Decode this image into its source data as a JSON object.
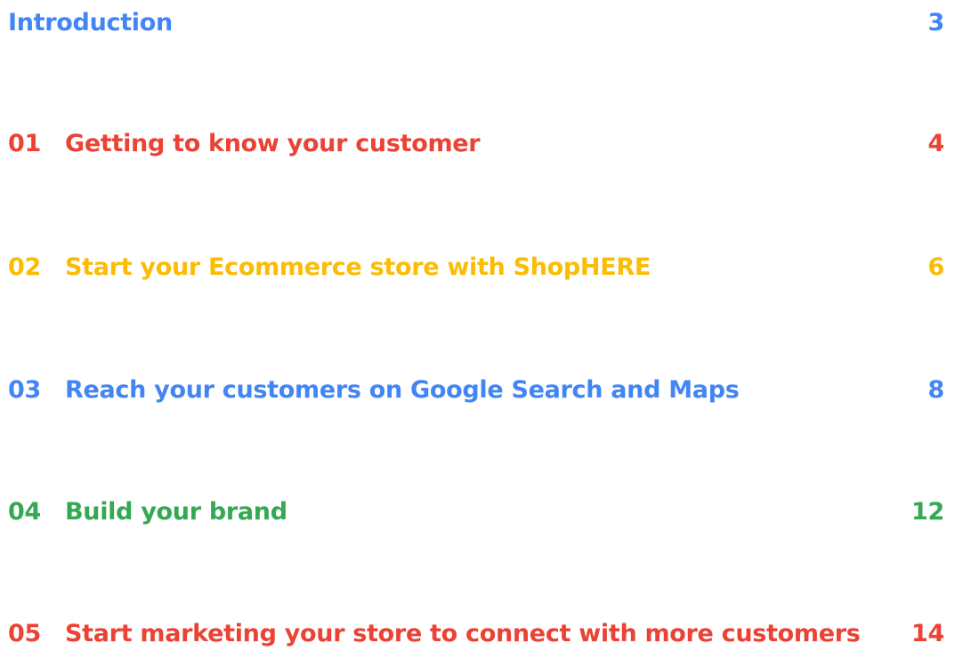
{
  "toc": {
    "entries": [
      {
        "number": "",
        "title": "Introduction",
        "page": "3",
        "color": "#4285F4"
      },
      {
        "number": "01",
        "title": "Getting to know your customer",
        "page": "4",
        "color": "#EA4335"
      },
      {
        "number": "02",
        "title": "Start your Ecommerce store with ShopHERE",
        "page": "6",
        "color": "#FBBC04"
      },
      {
        "number": "03",
        "title": "Reach your customers on Google Search and Maps",
        "page": "8",
        "color": "#4285F4"
      },
      {
        "number": "04",
        "title": "Build your brand",
        "page": "12",
        "color": "#34A853"
      },
      {
        "number": "05",
        "title": "Start marketing your store to connect with more customers",
        "page": "14",
        "color": "#EA4335"
      }
    ]
  }
}
